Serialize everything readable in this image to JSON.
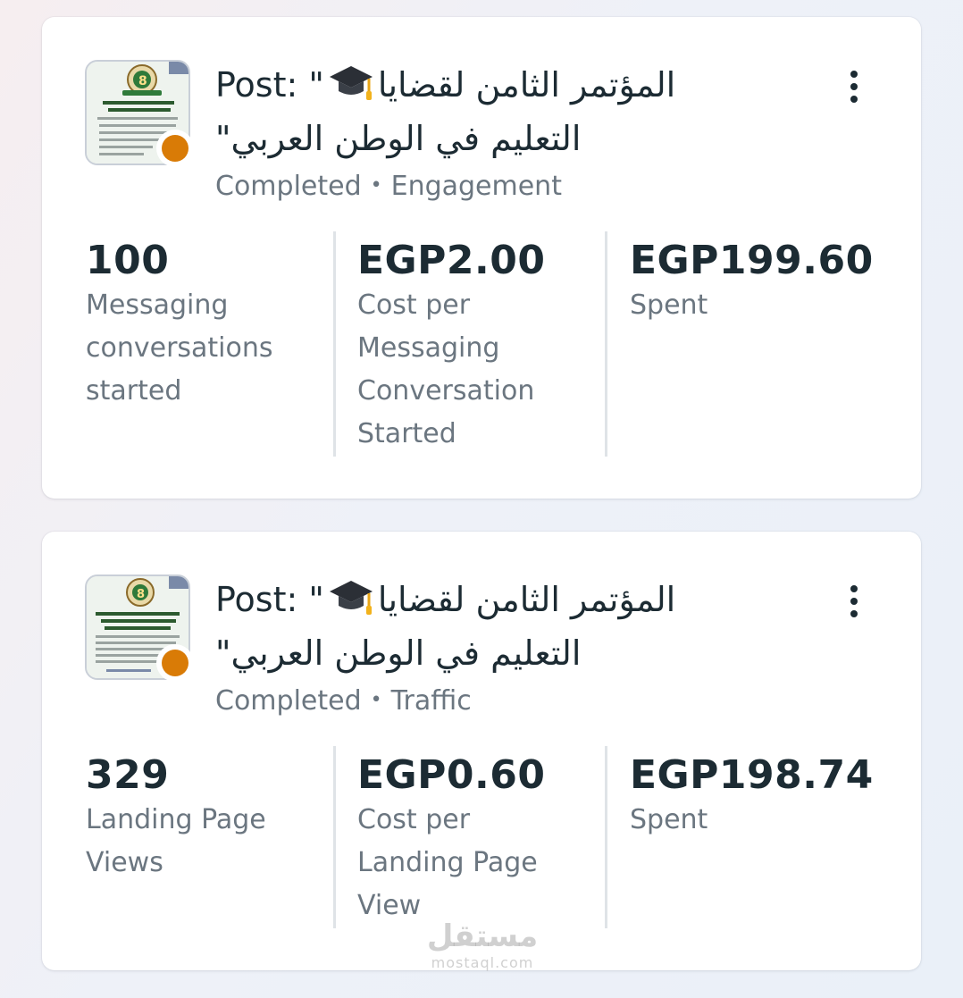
{
  "campaigns": [
    {
      "title_prefix": "Post: \"",
      "title_arabic_line1": "المؤتمر الثامن لقضايا",
      "title_arabic_line2": "التعليم في الوطن العربي\"",
      "status": "Completed",
      "separator": "•",
      "objective": "Engagement",
      "status_dot_color": "#d97b06",
      "thumb_icon": "conference-flyer-thumbnail",
      "metrics": [
        {
          "value": "100",
          "label": "Messaging conversations started"
        },
        {
          "value": "EGP2.00",
          "label": "Cost per Messaging Conversation Started"
        },
        {
          "value": "EGP199.60",
          "label": "Spent"
        }
      ]
    },
    {
      "title_prefix": "Post: \"",
      "title_arabic_line1": "المؤتمر الثامن لقضايا",
      "title_arabic_line2": "التعليم في الوطن العربي\"",
      "status": "Completed",
      "separator": "•",
      "objective": "Traffic",
      "status_dot_color": "#d97b06",
      "thumb_icon": "conference-flyer-thumbnail",
      "metrics": [
        {
          "value": "329",
          "label": "Landing Page Views"
        },
        {
          "value": "EGP0.60",
          "label": "Cost per Landing Page View"
        },
        {
          "value": "EGP198.74",
          "label": "Spent"
        }
      ]
    }
  ],
  "watermark": {
    "arabic": "مستقل",
    "latin": "mostaql.com"
  },
  "icons": {
    "menu": "more-vertical-icon",
    "title_emoji": "graduation-cap-icon"
  }
}
